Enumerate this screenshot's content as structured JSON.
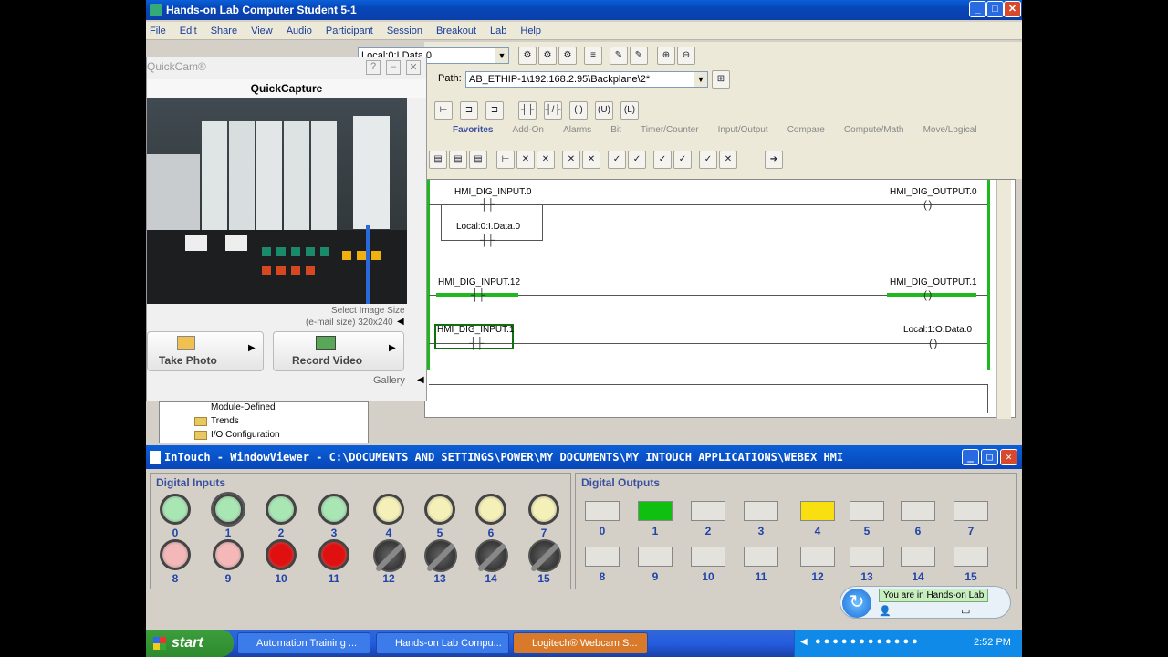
{
  "window": {
    "title": "Hands-on Lab Computer Student 5-1"
  },
  "menu": [
    "File",
    "Edit",
    "Share",
    "View",
    "Audio",
    "Participant",
    "Session",
    "Breakout",
    "Lab",
    "Help"
  ],
  "toolbar": {
    "tag_combo": "Local:0:I.Data.0",
    "path_label": "Path:",
    "path_value": "AB_ETHIP-1\\192.168.2.95\\Backplane\\2*"
  },
  "tabs": [
    "Favorites",
    "Add-On",
    "Alarms",
    "Bit",
    "Timer/Counter",
    "Input/Output",
    "Compare",
    "Compute/Math",
    "Move/Logical"
  ],
  "ladder": {
    "rung0": {
      "input": "HMI_DIG_INPUT.0",
      "branch": "Local:0:I.Data.0",
      "output": "HMI_DIG_OUTPUT.0"
    },
    "rung1": {
      "input": "HMI_DIG_INPUT.12",
      "output": "HMI_DIG_OUTPUT.1"
    },
    "rung2": {
      "input": "HMI_DIG_INPUT.1",
      "output": "Local:1:O.Data.0"
    }
  },
  "quickcam": {
    "app": "QuickCam®",
    "title": "QuickCapture",
    "select_size": "Select Image Size",
    "size_value": "(e-mail size) 320x240",
    "take_photo": "Take Photo",
    "record_video": "Record Video",
    "gallery": "Gallery"
  },
  "tree": [
    "Module-Defined",
    "Trends",
    "I/O Configuration"
  ],
  "intouch": {
    "title": "InTouch - WindowViewer - C:\\DOCUMENTS AND SETTINGS\\POWER\\MY DOCUMENTS\\MY INTOUCH APPLICATIONS\\WEBEX HMI",
    "inputs_title": "Digital Inputs",
    "outputs_title": "Digital Outputs",
    "inputs": [
      {
        "n": "0",
        "color": "#a8e6b4"
      },
      {
        "n": "1",
        "color": "#a8e6b4"
      },
      {
        "n": "2",
        "color": "#a8e6b4"
      },
      {
        "n": "3",
        "color": "#a8e6b4"
      },
      {
        "n": "4",
        "color": "#f4f0b8"
      },
      {
        "n": "5",
        "color": "#f4f0b8"
      },
      {
        "n": "6",
        "color": "#f4f0b8"
      },
      {
        "n": "7",
        "color": "#f4f0b8"
      },
      {
        "n": "8",
        "color": "#f4b8b8"
      },
      {
        "n": "9",
        "color": "#f4b8b8"
      },
      {
        "n": "10",
        "color": "#e01010"
      },
      {
        "n": "11",
        "color": "#e01010"
      },
      {
        "n": "12",
        "color": "knob"
      },
      {
        "n": "13",
        "color": "knob"
      },
      {
        "n": "14",
        "color": "knob"
      },
      {
        "n": "15",
        "color": "knob"
      }
    ],
    "outputs": [
      {
        "n": "0",
        "color": "#e4e2dc"
      },
      {
        "n": "1",
        "color": "#10c010"
      },
      {
        "n": "2",
        "color": "#e4e2dc"
      },
      {
        "n": "3",
        "color": "#e4e2dc"
      },
      {
        "n": "4",
        "color": "#f8e010"
      },
      {
        "n": "5",
        "color": "#e4e2dc"
      },
      {
        "n": "6",
        "color": "#e4e2dc"
      },
      {
        "n": "7",
        "color": "#e4e2dc"
      },
      {
        "n": "8",
        "color": "#e4e2dc"
      },
      {
        "n": "9",
        "color": "#e4e2dc"
      },
      {
        "n": "10",
        "color": "#e4e2dc"
      },
      {
        "n": "11",
        "color": "#e4e2dc"
      },
      {
        "n": "12",
        "color": "#e4e2dc"
      },
      {
        "n": "13",
        "color": "#e4e2dc"
      },
      {
        "n": "14",
        "color": "#e4e2dc"
      },
      {
        "n": "15",
        "color": "#e4e2dc"
      }
    ],
    "lab_badge": "You are in Hands-on Lab"
  },
  "taskbar": {
    "start": "start",
    "tasks": [
      "Automation Training ...",
      "Hands-on Lab Compu...",
      "Logitech® Webcam S..."
    ],
    "clock": "2:52 PM"
  }
}
